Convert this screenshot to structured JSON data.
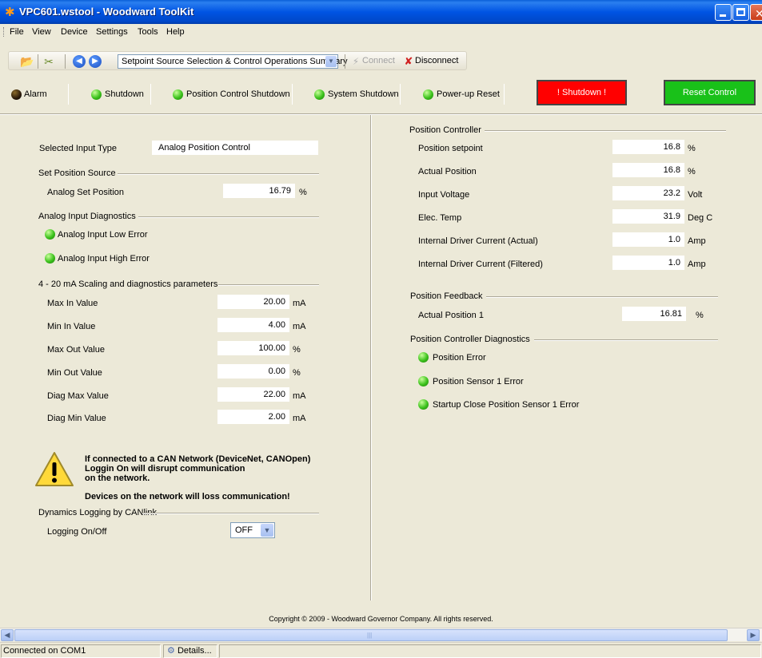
{
  "window": {
    "title": "VPC601.wstool - Woodward ToolKit"
  },
  "menu": [
    "File",
    "View",
    "Device",
    "Settings",
    "Tools",
    "Help"
  ],
  "toolbar": {
    "page_select": "Setpoint Source Selection & Control Operations Summary",
    "connect_label": "Connect",
    "disconnect_label": "Disconnect"
  },
  "status_strip": {
    "indicators": [
      {
        "label": "Alarm",
        "state": "dark"
      },
      {
        "label": "Shutdown",
        "state": "green"
      },
      {
        "label": "Position Control Shutdown",
        "state": "green"
      },
      {
        "label": "System Shutdown",
        "state": "green"
      },
      {
        "label": "Power-up Reset",
        "state": "green"
      }
    ],
    "shutdown_button": "! Shutdown !",
    "reset_button": "Reset Control"
  },
  "left": {
    "selected_input_type_label": "Selected Input Type",
    "selected_input_type_value": "Analog Position Control",
    "set_position_source": {
      "title": "Set Position Source",
      "label": "Analog Set Position",
      "value": "16.79",
      "unit": "%"
    },
    "analog_diag": {
      "title": "Analog Input Diagnostics",
      "items": [
        "Analog Input Low Error",
        "Analog Input High Error"
      ]
    },
    "scaling": {
      "title": "4 - 20 mA Scaling and diagnostics parameters",
      "rows": [
        {
          "label": "Max In Value",
          "value": "20.00",
          "unit": "mA"
        },
        {
          "label": "Min In Value",
          "value": "4.00",
          "unit": "mA"
        },
        {
          "label": "Max Out Value",
          "value": "100.00",
          "unit": "%"
        },
        {
          "label": "Min Out Value",
          "value": "0.00",
          "unit": "%"
        },
        {
          "label": "Diag Max Value",
          "value": "22.00",
          "unit": "mA"
        },
        {
          "label": "Diag Min Value",
          "value": "2.00",
          "unit": "mA"
        }
      ]
    },
    "warning": {
      "line1": "If connected to a CAN Network (DeviceNet, CANOpen)",
      "line2": "Loggin On will disrupt communication",
      "line3": "on the network.",
      "line4": "Devices on the network will loss communication!"
    },
    "logging": {
      "title": "Dynamics Logging by CANlink",
      "label": "Logging On/Off",
      "value": "OFF"
    }
  },
  "right": {
    "position_controller": {
      "title": "Position Controller",
      "rows": [
        {
          "label": "Position setpoint",
          "value": "16.8",
          "unit": "%"
        },
        {
          "label": "Actual Position",
          "value": "16.8",
          "unit": "%"
        },
        {
          "label": "Input Voltage",
          "value": "23.2",
          "unit": "Volt"
        },
        {
          "label": "Elec. Temp",
          "value": "31.9",
          "unit": "Deg C"
        },
        {
          "label": "Internal Driver Current (Actual)",
          "value": "1.0",
          "unit": "Amp"
        },
        {
          "label": "Internal Driver Current (Filtered)",
          "value": "1.0",
          "unit": "Amp"
        }
      ]
    },
    "position_feedback": {
      "title": "Position Feedback",
      "label": "Actual Position 1",
      "value": "16.81",
      "unit": "%"
    },
    "pc_diag": {
      "title": "Position Controller Diagnostics",
      "items": [
        "Position Error",
        "Position Sensor 1 Error",
        "Startup Close Position Sensor 1 Error"
      ]
    }
  },
  "copyright": "Copyright © 2009 - Woodward Governor Company. All rights reserved.",
  "statusbar": {
    "connection": "Connected on COM1",
    "details": "Details..."
  },
  "colors": {
    "title_blue": "#0054e3",
    "shutdown_red": "#ff0000",
    "reset_green": "#19c119",
    "led_green": "#3cc21c"
  }
}
